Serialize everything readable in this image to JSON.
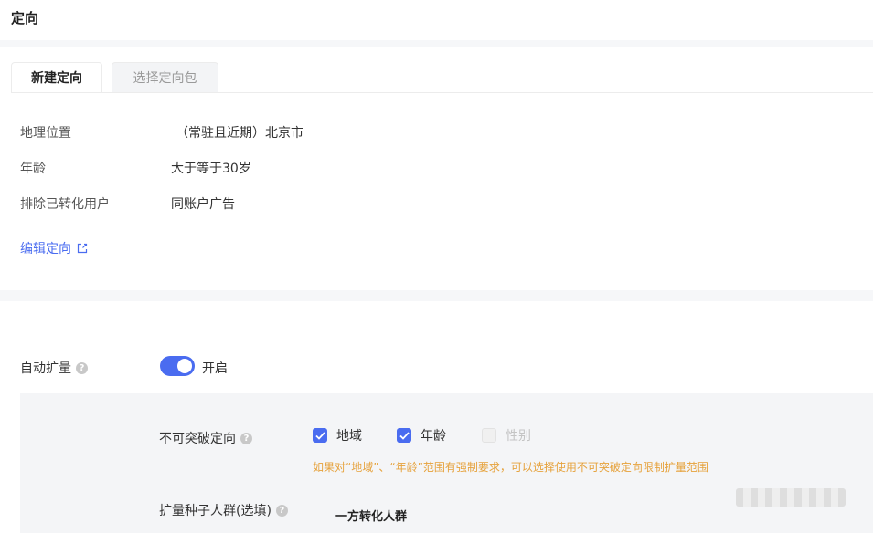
{
  "header": {
    "title": "定向"
  },
  "tabs": [
    {
      "label": "新建定向",
      "active": true
    },
    {
      "label": "选择定向包",
      "active": false
    }
  ],
  "summary": {
    "rows": [
      {
        "label": "地理位置",
        "value": "（常驻且近期）北京市"
      },
      {
        "label": "年龄",
        "value": "大于等于30岁"
      },
      {
        "label": "排除已转化用户",
        "value": "同账户广告"
      }
    ],
    "edit_label": "编辑定向"
  },
  "auto_expand": {
    "label": "自动扩量",
    "toggle_state": "on",
    "toggle_text": "开启",
    "unbreakable": {
      "label": "不可突破定向",
      "options": [
        {
          "label": "地域",
          "checked": true,
          "enabled": true
        },
        {
          "label": "年龄",
          "checked": true,
          "enabled": true
        },
        {
          "label": "性别",
          "checked": false,
          "enabled": false
        }
      ],
      "hint": "如果对“地域”、“年龄”范围有强制要求，可以选择使用不可突破定向限制扩量范围"
    },
    "seed": {
      "label": "扩量种子人群(选填)",
      "value": "一方转化人群"
    }
  },
  "colors": {
    "accent": "#4a6cf0",
    "warning": "#e6a23c"
  },
  "icons": {
    "help": "question-circle-icon",
    "edit": "external-edit-icon",
    "check": "checkmark-icon"
  }
}
